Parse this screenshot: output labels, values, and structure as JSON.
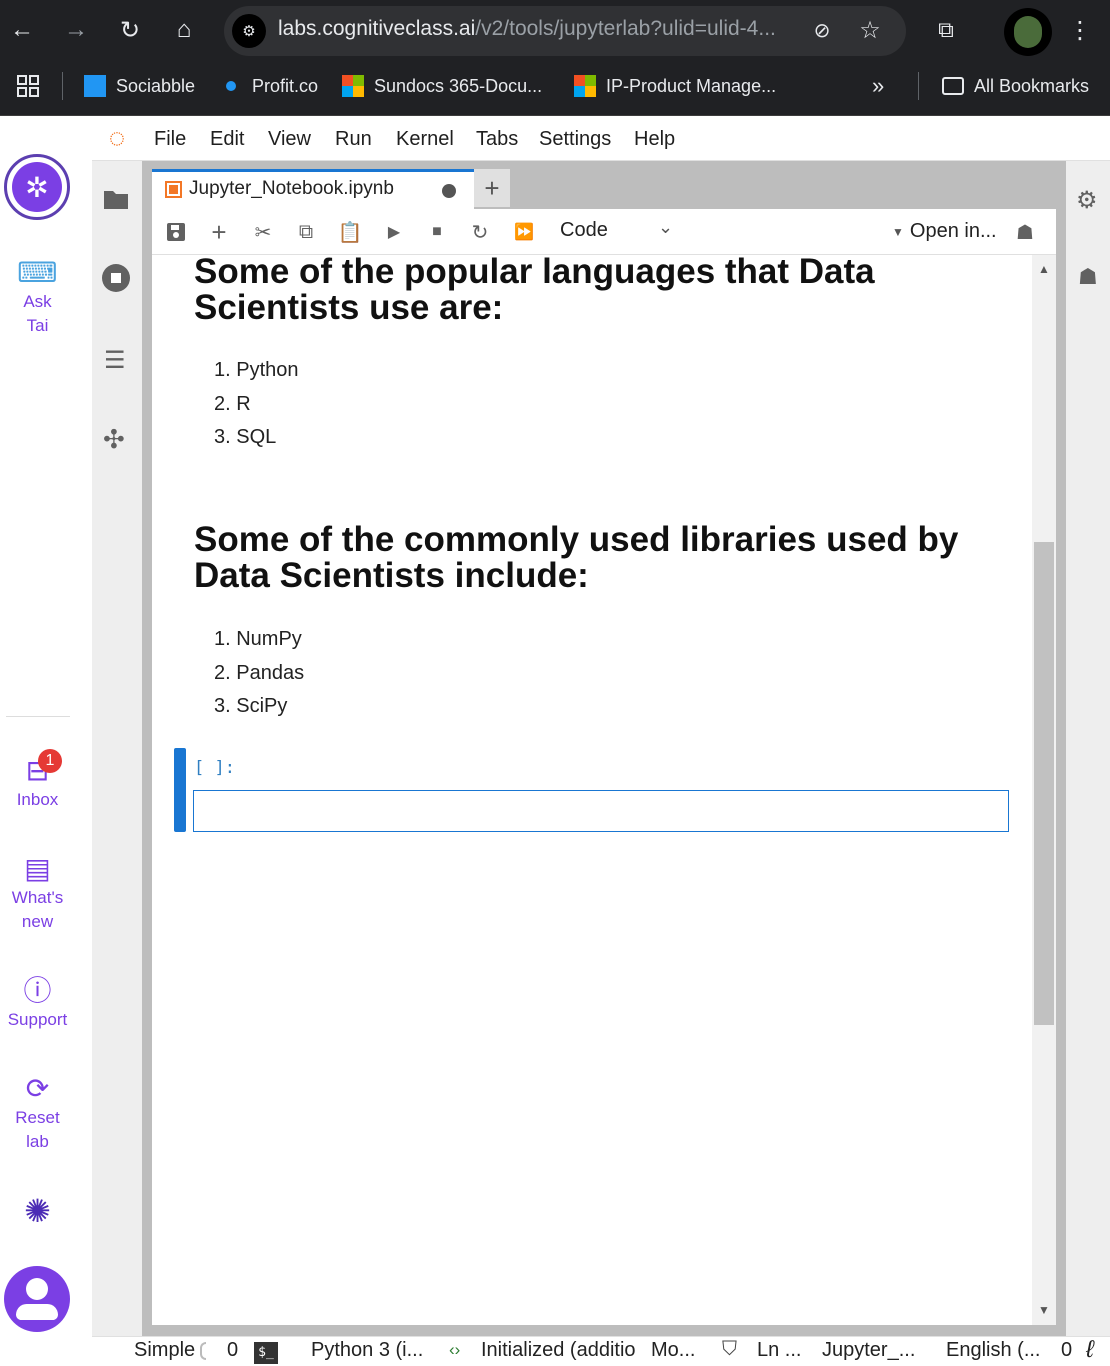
{
  "browser": {
    "url_host": "labs.cognitiveclass.ai",
    "url_rest": "/v2/tools/jupyterlab?ulid=ulid-4...",
    "bookmarks": [
      {
        "label": "Sociabble"
      },
      {
        "label": "Profit.co"
      },
      {
        "label": "Sundocs 365-Docu..."
      },
      {
        "label": "IP-Product Manage..."
      }
    ],
    "all_bookmarks": "All Bookmarks",
    "more": "»"
  },
  "lab_sidebar": {
    "ask": "Ask",
    "tai": "Tai",
    "inbox": "Inbox",
    "inbox_badge": "1",
    "whats": "What's",
    "new": "new",
    "support": "Support",
    "reset": "Reset",
    "lab": "lab"
  },
  "menu": [
    "File",
    "Edit",
    "View",
    "Run",
    "Kernel",
    "Tabs",
    "Settings",
    "Help"
  ],
  "tab": {
    "title": "Jupyter_Notebook.ipynb",
    "add": "+"
  },
  "toolbar": {
    "cell_type": "Code",
    "open_in": "Open in..."
  },
  "notebook": {
    "heading1_line1": "Some of the popular languages that Data",
    "heading1_line2": "Scientists use are:",
    "languages": [
      "1. Python",
      "2. R",
      "3. SQL"
    ],
    "heading2_line1": "Some of the commonly used libraries used by",
    "heading2_line2": "Data Scientists include:",
    "libraries": [
      "1. NumPy",
      "2. Pandas",
      "3. SciPy"
    ],
    "prompt": "[ ]:"
  },
  "status": {
    "simple": "Simple",
    "zero1": "0",
    "terminal": "$_",
    "kernel": "Python 3 (i...",
    "initialized": "Initialized (additio",
    "mode": "Mo...",
    "ln": "Ln ...",
    "file": "Jupyter_...",
    "lang": "English (...",
    "zero2": "0"
  },
  "colors": {
    "accent": "#1976d2",
    "brand": "#7b3fe4",
    "badge": "#e53935",
    "chrome_bg": "#202124"
  }
}
